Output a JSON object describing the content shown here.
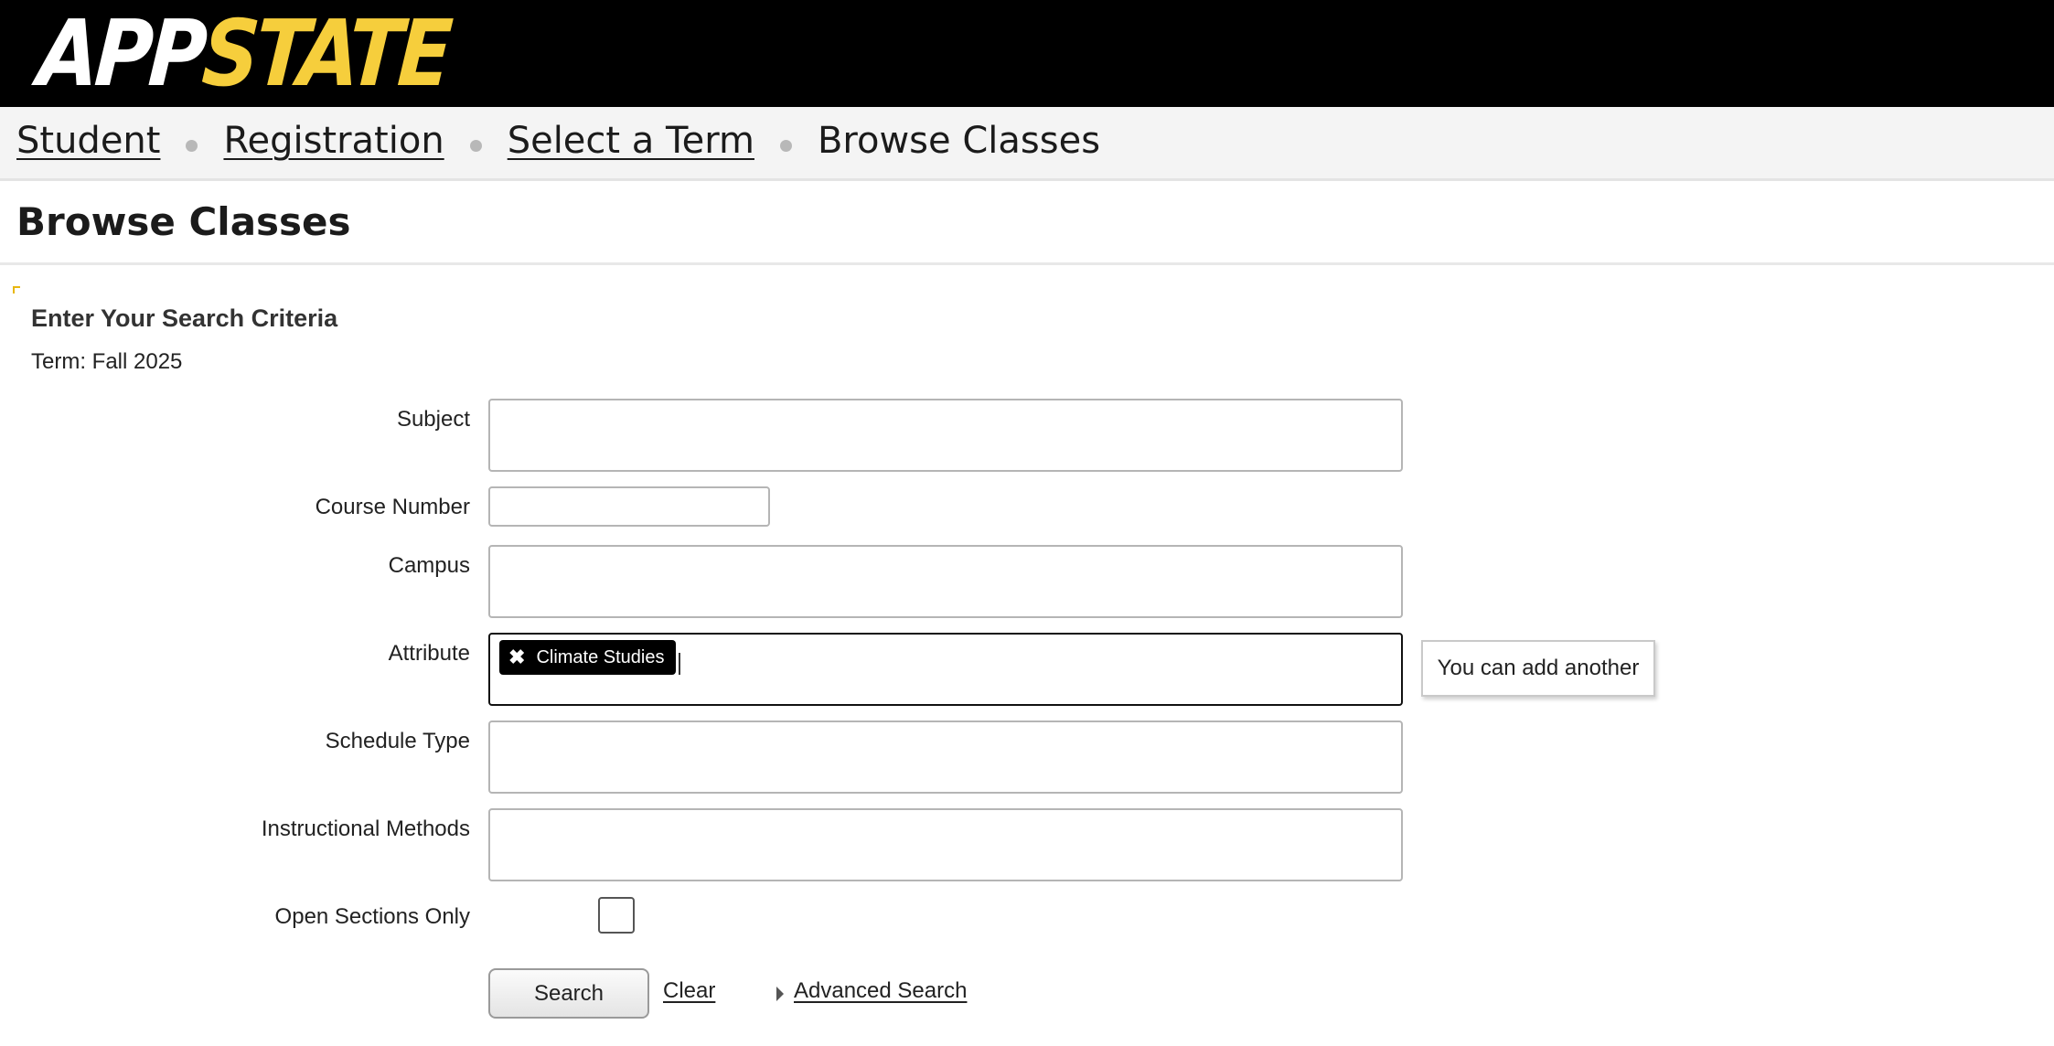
{
  "header": {
    "logo_app": "APP",
    "logo_state": "STATE"
  },
  "breadcrumb": {
    "items": [
      "Student",
      "Registration",
      "Select a Term"
    ],
    "current": "Browse Classes"
  },
  "page": {
    "title": "Browse Classes"
  },
  "criteria": {
    "heading": "Enter Your Search Criteria",
    "term_line": "Term: Fall 2025"
  },
  "form": {
    "subject_label": "Subject",
    "subject_value": "",
    "course_number_label": "Course Number",
    "course_number_value": "",
    "campus_label": "Campus",
    "campus_value": "",
    "attribute_label": "Attribute",
    "attribute_chips": [
      "Climate Studies"
    ],
    "attribute_chip_remove_icon": "✖",
    "attribute_tooltip": "You can add another",
    "schedule_type_label": "Schedule Type",
    "schedule_type_value": "",
    "instructional_methods_label": "Instructional Methods",
    "instructional_methods_value": "",
    "open_sections_label": "Open Sections Only",
    "open_sections_checked": false
  },
  "actions": {
    "search_label": "Search",
    "clear_label": "Clear",
    "advanced_search_label": "Advanced Search",
    "advanced_search_icon": "caret-right-icon"
  },
  "colors": {
    "header_bg": "#000000",
    "logo_accent": "#f6ce3c",
    "chip_bg": "#000000"
  }
}
